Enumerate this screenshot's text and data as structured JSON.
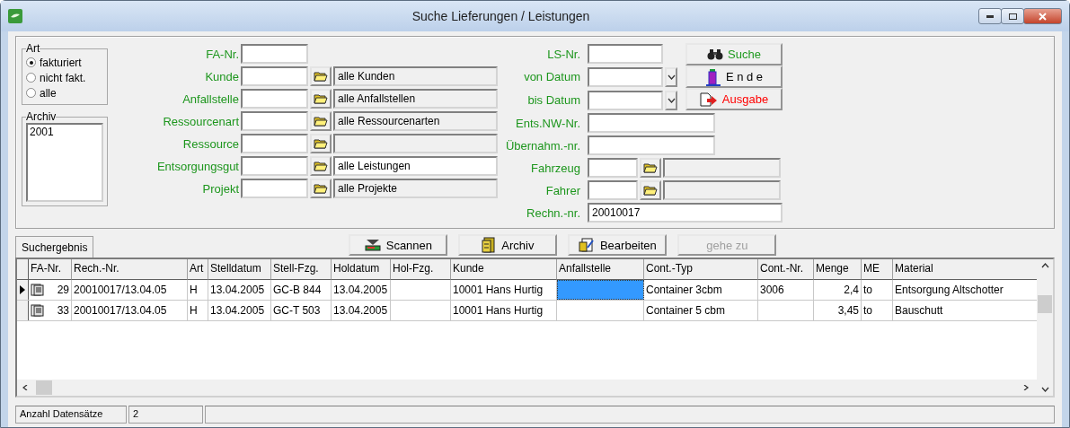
{
  "window": {
    "title": "Suche Lieferungen / Leistungen"
  },
  "art": {
    "title": "Art",
    "options": [
      {
        "label": "fakturiert",
        "selected": true
      },
      {
        "label": "nicht fakt.",
        "selected": false
      },
      {
        "label": "alle",
        "selected": false
      }
    ]
  },
  "archiv": {
    "title": "Archiv",
    "items": [
      "2001"
    ]
  },
  "left_fields": [
    {
      "label": "FA-Nr.",
      "kind": "plain"
    },
    {
      "label": "Kunde",
      "kind": "lookup",
      "display": "alle Kunden",
      "display_editable": false
    },
    {
      "label": "Anfallstelle",
      "kind": "lookup",
      "display": "alle Anfallstellen",
      "display_editable": false
    },
    {
      "label": "Ressourcenart",
      "kind": "lookup",
      "display": "alle Ressourcenarten",
      "display_editable": false
    },
    {
      "label": "Ressource",
      "kind": "lookup",
      "display_editable": false
    },
    {
      "label": "Entsorgungsgut",
      "kind": "lookup",
      "display": "alle Leistungen",
      "display_editable": true
    },
    {
      "label": "Projekt",
      "kind": "lookup",
      "display": "alle Projekte",
      "display_editable": false
    }
  ],
  "right_fields": [
    {
      "label": "LS-Nr.",
      "kind": "plain"
    },
    {
      "label": "von Datum",
      "kind": "date"
    },
    {
      "label": "bis Datum",
      "kind": "date"
    },
    {
      "label": "Ents.NW-Nr.",
      "kind": "wide"
    },
    {
      "label": "Übernahm.-nr.",
      "kind": "wide"
    },
    {
      "label": "Fahrzeug",
      "kind": "lookup"
    },
    {
      "label": "Fahrer",
      "kind": "lookup"
    },
    {
      "label": "Rechn.-nr.",
      "kind": "long",
      "value": "20010017"
    }
  ],
  "action_buttons": [
    {
      "label": "Suche",
      "kind": "search",
      "color": "#1e9a1e"
    },
    {
      "label": "E n d e",
      "kind": "exit",
      "color": "#000000"
    },
    {
      "label": "Ausgabe",
      "kind": "output",
      "color": "#ff0000"
    }
  ],
  "tabs": [
    {
      "label": "Suchergebnis",
      "selected": true
    }
  ],
  "result_buttons": [
    {
      "label": "Scannen",
      "kind": "scan",
      "disabled": false
    },
    {
      "label": "Archiv",
      "kind": "archive",
      "disabled": false
    },
    {
      "label": "Bearbeiten",
      "kind": "edit",
      "disabled": false
    },
    {
      "label": "gehe zu",
      "kind": "none",
      "disabled": true
    }
  ],
  "table": {
    "columns": [
      {
        "label": "FA-Nr.",
        "kind": "number"
      },
      {
        "label": "Rech.-Nr.",
        "kind": "text"
      },
      {
        "label": "Art",
        "kind": "text"
      },
      {
        "label": "Stelldatum",
        "kind": "text"
      },
      {
        "label": "Stell-Fzg.",
        "kind": "text"
      },
      {
        "label": "Holdatum",
        "kind": "text"
      },
      {
        "label": "Hol-Fzg.",
        "kind": "text"
      },
      {
        "label": "Kunde",
        "kind": "text"
      },
      {
        "label": "Anfallstelle",
        "kind": "text"
      },
      {
        "label": "Cont.-Typ",
        "kind": "text"
      },
      {
        "label": "Cont.-Nr.",
        "kind": "text"
      },
      {
        "label": "Menge",
        "kind": "number"
      },
      {
        "label": "ME",
        "kind": "text"
      },
      {
        "label": "Material",
        "kind": "text"
      }
    ],
    "rows": [
      {
        "selected": true,
        "cells": [
          {
            "text": "29"
          },
          {
            "text": "20010017/13.04.05"
          },
          {
            "text": "H"
          },
          {
            "text": "13.04.2005"
          },
          {
            "text": "GC-B 844"
          },
          {
            "text": "13.04.2005"
          },
          {},
          {
            "text": "10001 Hans Hurtig"
          },
          {
            "focused": true
          },
          {
            "text": "Container 3cbm"
          },
          {
            "text": "3006"
          },
          {
            "text": "2,4"
          },
          {
            "text": "to"
          },
          {
            "text": "Entsorgung Altschotter"
          }
        ]
      },
      {
        "selected": false,
        "cells": [
          {
            "text": "33"
          },
          {
            "text": "20010017/13.04.05"
          },
          {
            "text": "H"
          },
          {
            "text": "13.04.2005"
          },
          {
            "text": "GC-T 503"
          },
          {
            "text": "13.04.2005"
          },
          {},
          {
            "text": "10001 Hans Hurtig"
          },
          {},
          {
            "text": "Container 5 cbm"
          },
          {},
          {
            "text": "3,45"
          },
          {
            "text": "to"
          },
          {
            "text": "Bauschutt"
          }
        ]
      }
    ]
  },
  "status_bar": {
    "label": "Anzahl Datensätze",
    "count": "2"
  }
}
